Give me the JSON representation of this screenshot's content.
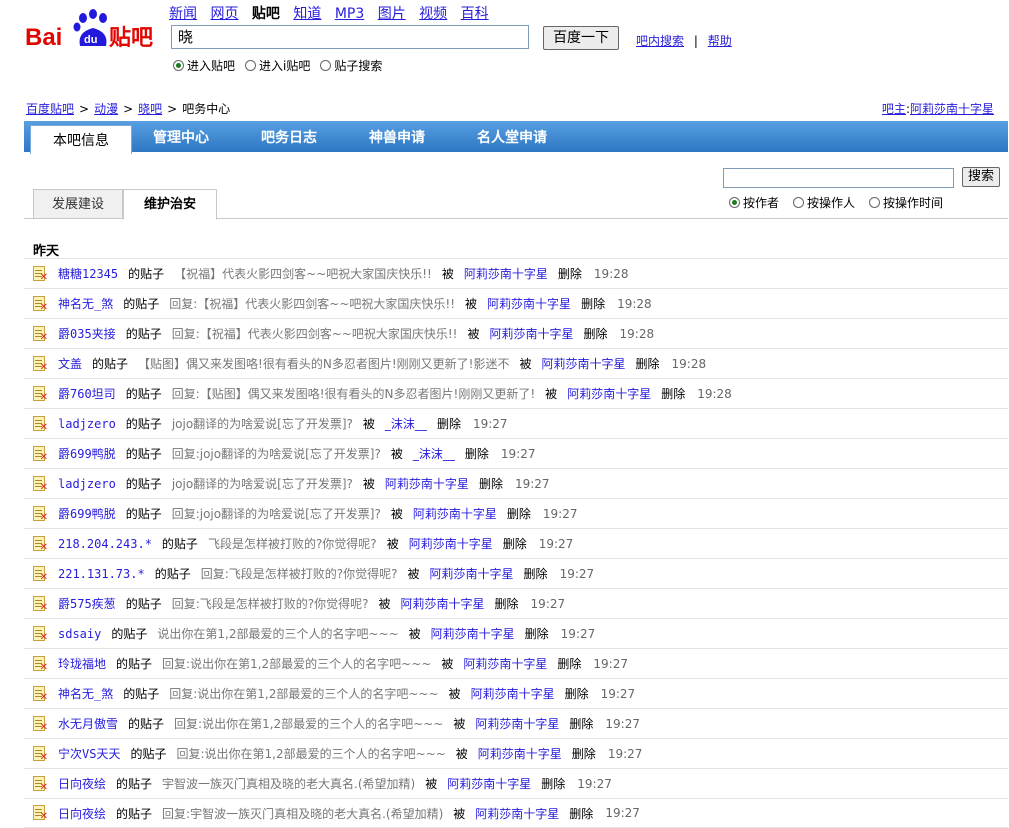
{
  "header": {
    "logo_text": "Bai du 贴吧",
    "nav": [
      "新闻",
      "网页",
      "贴吧",
      "知道",
      "MP3",
      "图片",
      "视频",
      "百科"
    ],
    "active_nav": "贴吧",
    "search_value": "晓",
    "search_button": "百度一下",
    "inner_search": "吧内搜索",
    "separator": "|",
    "help": "帮助",
    "radios": [
      "进入贴吧",
      "进入i贴吧",
      "贴子搜索"
    ]
  },
  "breadcrumb": {
    "items": [
      "百度贴吧",
      "动漫",
      "晓吧",
      "吧务中心"
    ],
    "gt": ">"
  },
  "owner": {
    "label": "吧主",
    "colon": ":",
    "name": "阿莉莎南十字星"
  },
  "main_tabs": [
    "本吧信息",
    "管理中心",
    "吧务日志",
    "神兽申请",
    "名人堂申请"
  ],
  "right_search": {
    "button": "搜索",
    "radios": [
      "按作者",
      "按操作人",
      "按操作时间"
    ]
  },
  "sub_tabs": [
    "发展建设",
    "维护治安"
  ],
  "day_heading": "昨天",
  "labels": {
    "of_post": "的贴子",
    "by": "被",
    "action": "删除"
  },
  "rows": [
    {
      "user": "糖糖12345",
      "title": "【祝福】代表火影四剑客~~吧祝大家国庆快乐!!",
      "op": "阿莉莎南十字星",
      "time": "19:28"
    },
    {
      "user": "神名无_煞",
      "title": "回复:【祝福】代表火影四剑客~~吧祝大家国庆快乐!!",
      "op": "阿莉莎南十字星",
      "time": "19:28"
    },
    {
      "user": "爵035夹接",
      "title": "回复:【祝福】代表火影四剑客~~吧祝大家国庆快乐!!",
      "op": "阿莉莎南十字星",
      "time": "19:28"
    },
    {
      "user": "文盖",
      "title": "【贴图】偶又来发图咯!很有看头的N多忍者图片!刚刚又更新了!影迷不",
      "op": "阿莉莎南十字星",
      "time": "19:28"
    },
    {
      "user": "爵760坦司",
      "title": "回复:【贴图】偶又来发图咯!很有看头的N多忍者图片!刚刚又更新了!",
      "op": "阿莉莎南十字星",
      "time": "19:28"
    },
    {
      "user": "ladjzero",
      "title": "jojo翻译的为啥爱说[忘了开发票]?",
      "op": "_沫沫__",
      "time": "19:27"
    },
    {
      "user": "爵699鸭脱",
      "title": "回复:jojo翻译的为啥爱说[忘了开发票]?",
      "op": "_沫沫__",
      "time": "19:27"
    },
    {
      "user": "ladjzero",
      "title": "jojo翻译的为啥爱说[忘了开发票]?",
      "op": "阿莉莎南十字星",
      "time": "19:27"
    },
    {
      "user": "爵699鸭脱",
      "title": "回复:jojo翻译的为啥爱说[忘了开发票]?",
      "op": "阿莉莎南十字星",
      "time": "19:27"
    },
    {
      "user": "218.204.243.*",
      "title": "飞段是怎样被打败的?你觉得呢?",
      "op": "阿莉莎南十字星",
      "time": "19:27"
    },
    {
      "user": "221.131.73.*",
      "title": "回复:飞段是怎样被打败的?你觉得呢?",
      "op": "阿莉莎南十字星",
      "time": "19:27"
    },
    {
      "user": "爵575疾葱",
      "title": "回复:飞段是怎样被打败的?你觉得呢?",
      "op": "阿莉莎南十字星",
      "time": "19:27"
    },
    {
      "user": "sdsaiy",
      "title": "说出你在第1,2部最爱的三个人的名字吧~~~",
      "op": "阿莉莎南十字星",
      "time": "19:27"
    },
    {
      "user": "玲珑福地",
      "title": "回复:说出你在第1,2部最爱的三个人的名字吧~~~",
      "op": "阿莉莎南十字星",
      "time": "19:27"
    },
    {
      "user": "神名无_煞",
      "title": "回复:说出你在第1,2部最爱的三个人的名字吧~~~",
      "op": "阿莉莎南十字星",
      "time": "19:27"
    },
    {
      "user": "水无月傲雪",
      "title": "回复:说出你在第1,2部最爱的三个人的名字吧~~~",
      "op": "阿莉莎南十字星",
      "time": "19:27"
    },
    {
      "user": "宁次VS天天",
      "title": "回复:说出你在第1,2部最爱的三个人的名字吧~~~",
      "op": "阿莉莎南十字星",
      "time": "19:27"
    },
    {
      "user": "日向夜绘",
      "title": "宇智波一族灭门真相及晓的老大真名.(希望加精)",
      "op": "阿莉莎南十字星",
      "time": "19:27"
    },
    {
      "user": "日向夜绘",
      "title": "回复:宇智波一族灭门真相及晓的老大真名.(希望加精)",
      "op": "阿莉莎南十字星",
      "time": "19:27"
    }
  ]
}
